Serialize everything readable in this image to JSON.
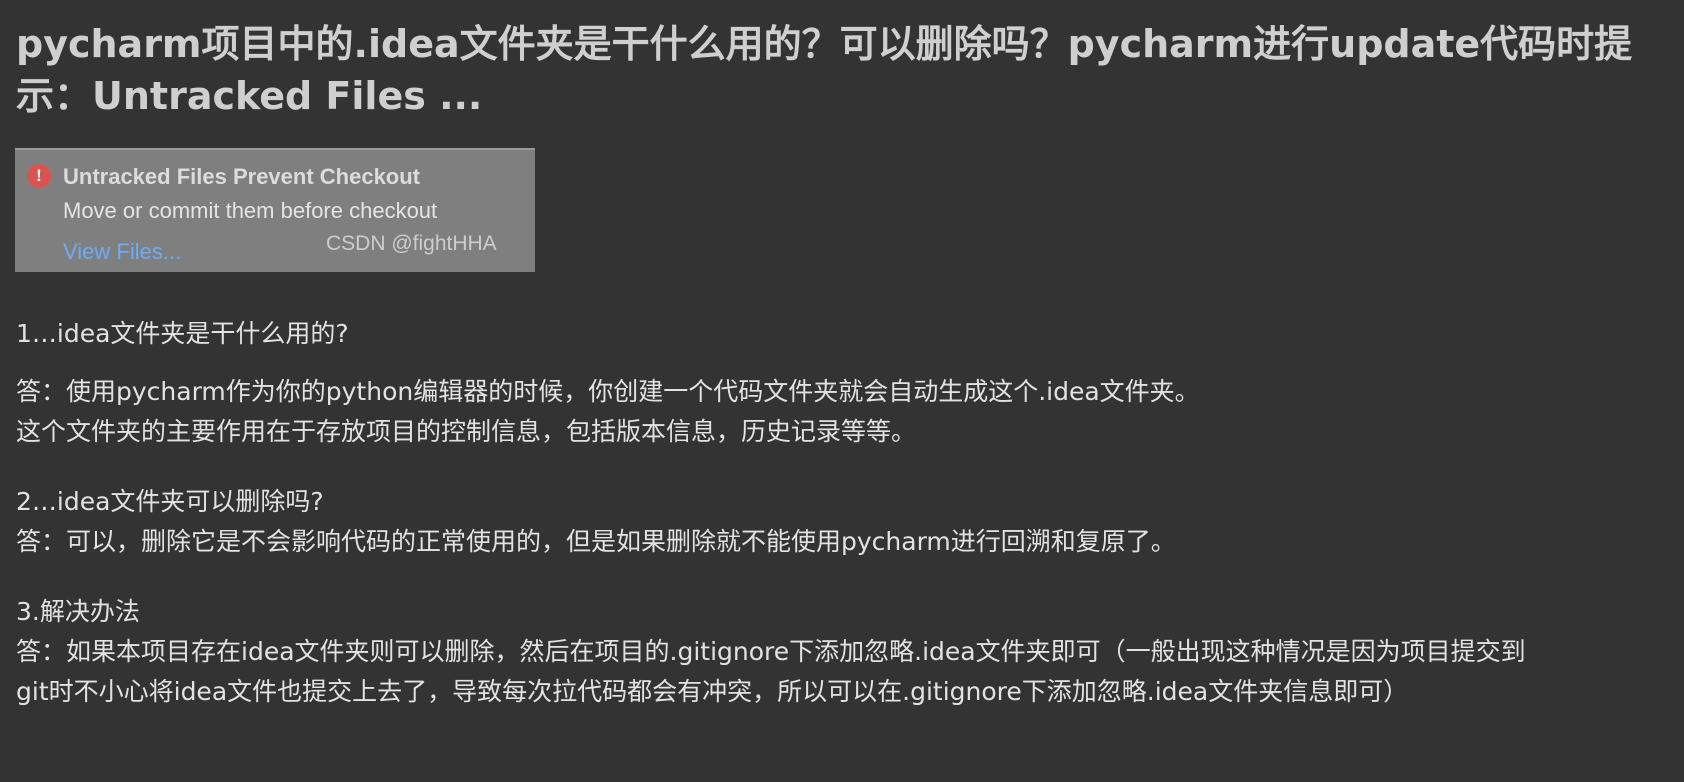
{
  "article": {
    "title": "pycharm项目中的.idea文件夹是干什么用的？可以删除吗？pycharm进行update代码时提示：Untracked Files ..."
  },
  "notice": {
    "icon": "error-icon",
    "title": "Untracked Files Prevent Checkout",
    "subtitle": "Move or commit them before checkout",
    "link": "View Files...",
    "watermark": "CSDN @fightHHA"
  },
  "sections": [
    {
      "lines": [
        "1…idea文件夹是干什么用的?",
        ""
      ]
    },
    {
      "lines": [
        "答：使用pycharm作为你的python编辑器的时候，你创建一个代码文件夹就会自动生成这个.idea文件夹。",
        "这个文件夹的主要作用在于存放项目的控制信息，包括版本信息，历史记录等等。"
      ]
    },
    {
      "lines": [
        "2…idea文件夹可以删除吗?",
        "答：可以，删除它是不会影响代码的正常使用的，但是如果删除就不能使用pycharm进行回溯和复原了。"
      ]
    },
    {
      "lines": [
        "3.解决办法",
        "答：如果本项目存在idea文件夹则可以删除，然后在项目的.gitignore下添加忽略.idea文件夹即可（一般出现这种情况是因为项目提交到",
        "git时不小心将idea文件也提交上去了，导致每次拉代码都会有冲突，所以可以在.gitignore下添加忽略.idea文件夹信息即可）"
      ]
    }
  ]
}
